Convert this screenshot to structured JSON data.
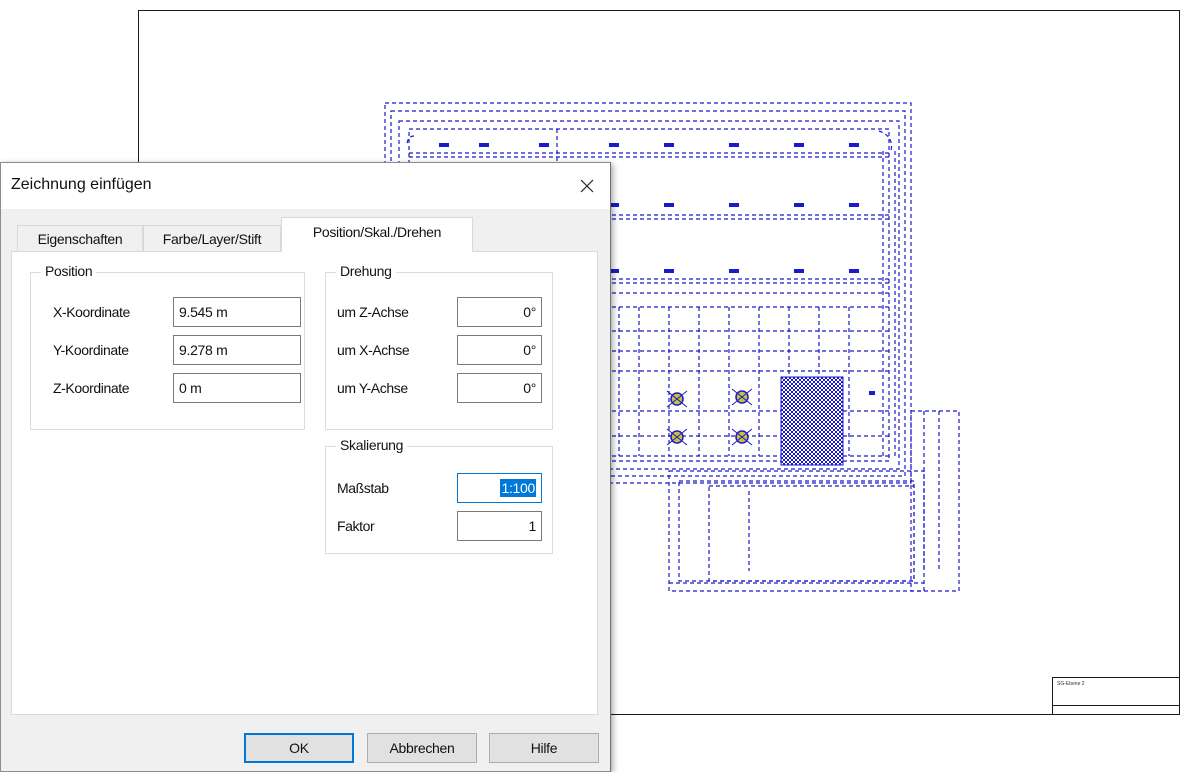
{
  "dialog": {
    "title": "Zeichnung einfügen",
    "close_icon": "close-icon",
    "tabs": [
      {
        "label": "Eigenschaften",
        "active": false
      },
      {
        "label": "Farbe/Layer/Stift",
        "active": false
      },
      {
        "label": "Position/Skal./Drehen",
        "active": true
      }
    ],
    "position": {
      "legend": "Position",
      "rows": [
        {
          "label": "X-Koordinate",
          "value": "9.545 m"
        },
        {
          "label": "Y-Koordinate",
          "value": "9.278 m"
        },
        {
          "label": "Z-Koordinate",
          "value": "0 m"
        }
      ]
    },
    "rotation": {
      "legend": "Drehung",
      "rows": [
        {
          "label": "um Z-Achse",
          "value": "0°"
        },
        {
          "label": "um X-Achse",
          "value": "0°"
        },
        {
          "label": "um Y-Achse",
          "value": "0°"
        }
      ]
    },
    "scaling": {
      "legend": "Skalierung",
      "scale_label": "Maßstab",
      "scale_value": "1:100",
      "factor_label": "Faktor",
      "factor_value": "1"
    },
    "buttons": {
      "ok": "OK",
      "cancel": "Abbrechen",
      "help": "Hilfe"
    }
  },
  "sheet": {
    "titleblock_text": "SG-Ebene 2",
    "drawing_color": "#1a1acc"
  }
}
